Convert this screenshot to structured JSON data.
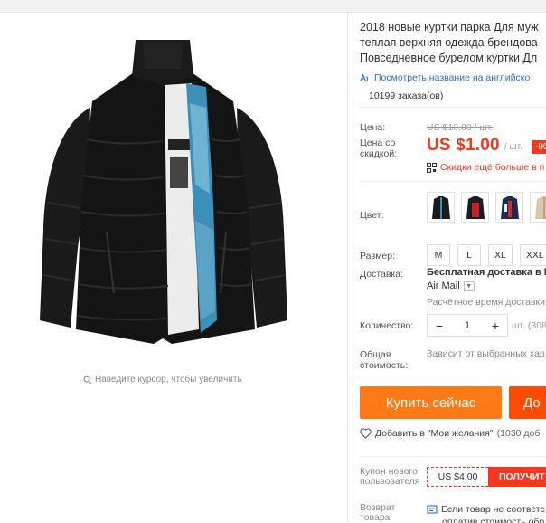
{
  "gallery": {
    "zoom_hint": "Наведите курсор, чтобы увеличить",
    "image_icon": "jacket-photo"
  },
  "product": {
    "title_lines": [
      "2018 новые куртки парка Для муж",
      "теплая верхняя одежда брендова",
      "Повседневное бурелом куртки Дл"
    ],
    "translate_link": "Посмотреть название на английско",
    "orders": "10199 заказа(ов)"
  },
  "pricing": {
    "price_label": "Цена:",
    "old_price": "US $10.00 / шт.",
    "discount_label_1": "Цена со",
    "discount_label_2": "скидкой:",
    "price": "US $1.00",
    "unit": "/ шт.",
    "discount_badge": "-90",
    "more_discounts": "Скидки ещё больше в п",
    "accent_color": "#f4381e"
  },
  "options": {
    "color_label": "Цвет:",
    "colors": [
      "black",
      "red-black",
      "navy-red",
      "beige"
    ],
    "size_label": "Размер:",
    "sizes": [
      "M",
      "L",
      "XL",
      "XXL"
    ]
  },
  "shipping": {
    "label": "Доставка:",
    "main": "Бесплатная доставка в R",
    "method": "Air Mail",
    "estimate": "Расчётное время доставки"
  },
  "quantity": {
    "label": "Количество:",
    "minus": "−",
    "value": "1",
    "plus": "+",
    "stock": "шт. (308"
  },
  "total": {
    "label_1": "Общая",
    "label_2": "стоимость:",
    "value": "Зависит от выбранных хар"
  },
  "actions": {
    "buy_now": "Купить сейчас",
    "add_to_cart": "До",
    "wishlist": "Добавить в \"Мои желания\"",
    "wishlist_count": "(1030 доб"
  },
  "coupon": {
    "label_1": "Купон нового",
    "label_2": "пользователя",
    "amount": "US $4.00",
    "get": "ПОЛУЧИТ"
  },
  "returns": {
    "label_1": "Возврат",
    "label_2": "товара",
    "line_1": "Если товар не соответс",
    "line_2": "оплатив стоимость обр"
  }
}
